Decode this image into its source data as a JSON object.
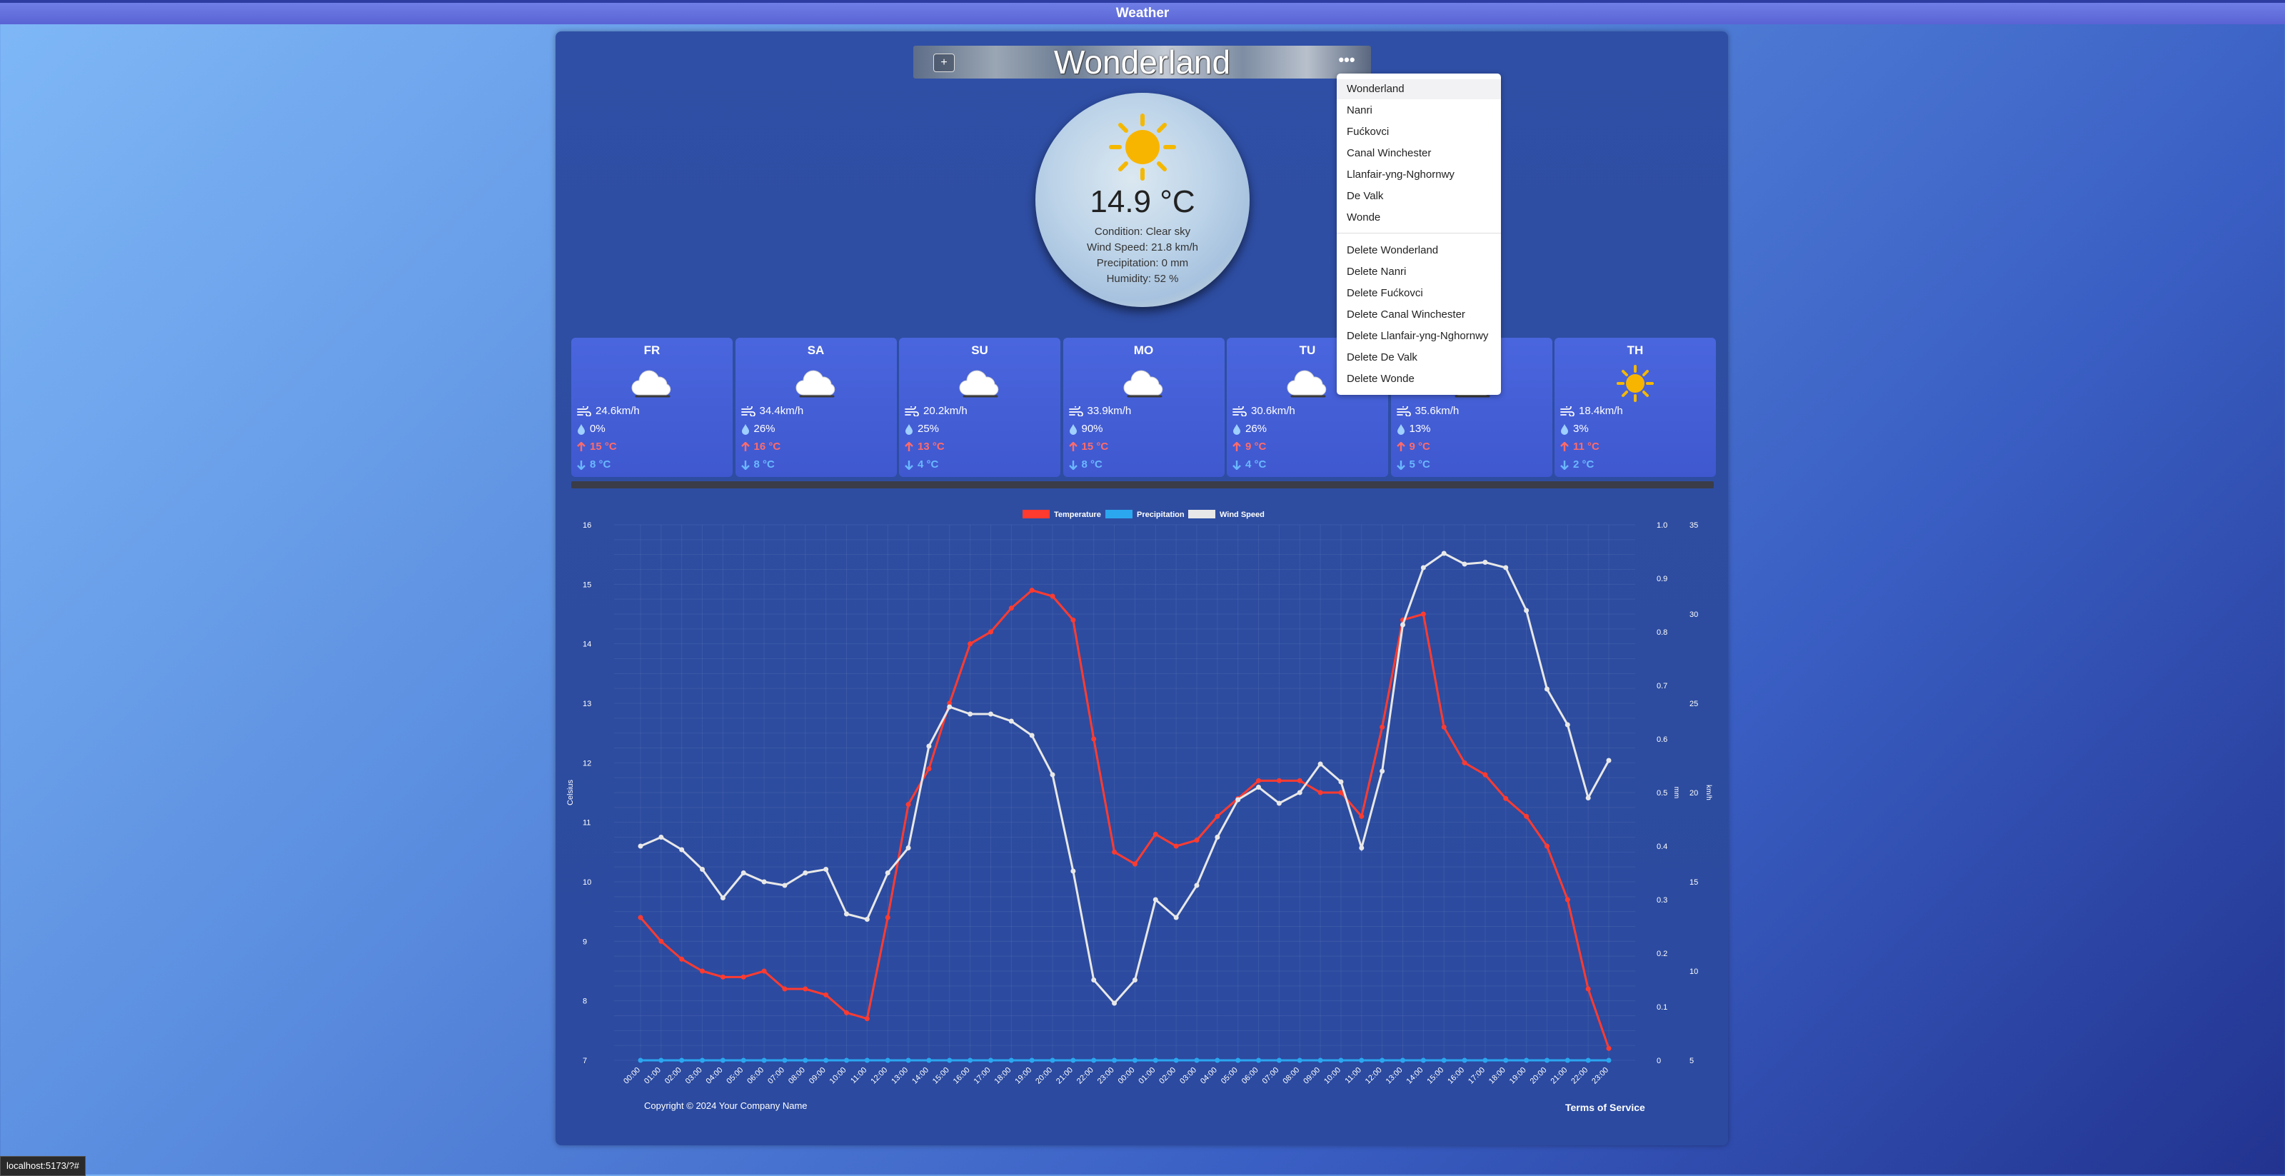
{
  "app": {
    "title": "Weather"
  },
  "location": {
    "name": "Wonderland",
    "add_label": "+",
    "more_label": "•••"
  },
  "menu": {
    "locations": [
      "Wonderland",
      "Nanri",
      "Fućkovci",
      "Canal Winchester",
      "Llanfair-yng-Nghornwy",
      "De Valk",
      "Wonde"
    ],
    "deletes": [
      "Delete Wonderland",
      "Delete Nanri",
      "Delete Fućkovci",
      "Delete Canal Winchester",
      "Delete Llanfair-yng-Nghornwy",
      "Delete De Valk",
      "Delete Wonde"
    ]
  },
  "current": {
    "temperature": "14.9 °C",
    "condition": "Condition: Clear sky",
    "wind": "Wind Speed: 21.8 km/h",
    "precipitation": "Precipitation: 0 mm",
    "humidity": "Humidity: 52 %",
    "icon": "sun-icon"
  },
  "forecast": [
    {
      "day": "FR",
      "icon": "cloud-icon",
      "wind": "24.6km/h",
      "precip": "0%",
      "high": "15 °C",
      "low": "8 °C"
    },
    {
      "day": "SA",
      "icon": "cloud-icon",
      "wind": "34.4km/h",
      "precip": "26%",
      "high": "16 °C",
      "low": "8 °C"
    },
    {
      "day": "SU",
      "icon": "cloud-icon",
      "wind": "20.2km/h",
      "precip": "25%",
      "high": "13 °C",
      "low": "4 °C"
    },
    {
      "day": "MO",
      "icon": "cloud-icon",
      "wind": "33.9km/h",
      "precip": "90%",
      "high": "15 °C",
      "low": "8 °C"
    },
    {
      "day": "TU",
      "icon": "cloud-icon",
      "wind": "30.6km/h",
      "precip": "26%",
      "high": "9 °C",
      "low": "4 °C"
    },
    {
      "day": "",
      "icon": "cloud-icon",
      "wind": "35.6km/h",
      "precip": "13%",
      "high": "9 °C",
      "low": "5 °C"
    },
    {
      "day": "TH",
      "icon": "sun-icon",
      "wind": "18.4km/h",
      "precip": "3%",
      "high": "11 °C",
      "low": "2 °C"
    }
  ],
  "chart_data": {
    "type": "line",
    "legend": [
      "Temperature",
      "Precipitation",
      "Wind Speed"
    ],
    "colors": {
      "temperature": "#ff3b30",
      "precipitation": "#2ba7f0",
      "wind": "#e8e8e8"
    },
    "x": [
      "00:00",
      "01:00",
      "02:00",
      "03:00",
      "04:00",
      "05:00",
      "06:00",
      "07:00",
      "08:00",
      "09:00",
      "10:00",
      "11:00",
      "12:00",
      "13:00",
      "14:00",
      "15:00",
      "16:00",
      "17:00",
      "18:00",
      "19:00",
      "20:00",
      "21:00",
      "22:00",
      "23:00",
      "00:00",
      "01:00",
      "02:00",
      "03:00",
      "04:00",
      "05:00",
      "06:00",
      "07:00",
      "08:00",
      "09:00",
      "10:00",
      "11:00",
      "12:00",
      "13:00",
      "14:00",
      "15:00",
      "16:00",
      "17:00",
      "18:00",
      "19:00",
      "20:00",
      "21:00",
      "22:00",
      "23:00"
    ],
    "series": [
      {
        "name": "Temperature",
        "axis": "Celsius",
        "values": [
          9.4,
          9.0,
          8.7,
          8.5,
          8.4,
          8.4,
          8.5,
          8.2,
          8.2,
          8.1,
          7.8,
          7.7,
          9.4,
          11.3,
          11.9,
          13.0,
          14.0,
          14.2,
          14.6,
          14.9,
          14.8,
          14.4,
          12.4,
          10.5,
          10.3,
          10.8,
          10.6,
          10.7,
          11.1,
          11.4,
          11.7,
          11.7,
          11.7,
          11.5,
          11.5,
          11.1,
          12.6,
          14.4,
          14.5,
          12.6,
          12.0,
          11.8,
          11.4,
          11.1,
          10.6,
          9.7,
          8.2,
          7.2
        ]
      },
      {
        "name": "Precipitation",
        "axis": "mm",
        "values": [
          0,
          0,
          0,
          0,
          0,
          0,
          0,
          0,
          0,
          0,
          0,
          0,
          0,
          0,
          0,
          0,
          0,
          0,
          0,
          0,
          0,
          0,
          0,
          0,
          0,
          0,
          0,
          0,
          0,
          0,
          0,
          0,
          0,
          0,
          0,
          0,
          0,
          0,
          0,
          0,
          0,
          0,
          0,
          0,
          0,
          0,
          0,
          0
        ]
      },
      {
        "name": "Wind Speed",
        "axis": "km/h",
        "values": [
          17.0,
          17.5,
          16.8,
          15.7,
          14.1,
          15.5,
          15.0,
          14.8,
          15.5,
          15.7,
          13.2,
          12.9,
          15.5,
          16.9,
          22.6,
          24.8,
          24.4,
          24.4,
          24.0,
          23.2,
          21.0,
          15.6,
          9.5,
          8.2,
          9.5,
          14.0,
          13.0,
          14.8,
          17.5,
          19.6,
          20.3,
          19.4,
          20.0,
          21.6,
          20.6,
          16.9,
          21.2,
          29.4,
          32.6,
          33.4,
          32.8,
          32.9,
          32.6,
          30.2,
          25.8,
          23.8,
          19.7,
          21.8
        ]
      }
    ],
    "y_left": {
      "label": "Celsius",
      "ticks": [
        7,
        8,
        9,
        10,
        11,
        12,
        13,
        14,
        15,
        16
      ],
      "range": [
        7,
        16
      ]
    },
    "y_right1": {
      "label": "mm",
      "ticks": [
        "0",
        "0.1",
        "0.2",
        "0.3",
        "0.4",
        "0.5",
        "0.6",
        "0.7",
        "0.8",
        "0.9",
        "1.0"
      ],
      "range": [
        0,
        1
      ]
    },
    "y_right2": {
      "label": "km/h",
      "ticks": [
        5,
        10,
        15,
        20,
        25,
        30,
        35
      ],
      "range": [
        5,
        35
      ]
    },
    "grid": true,
    "legend_position": "top-center"
  },
  "footer": {
    "copyright": "Copyright © 2024 Your Company Name",
    "terms": "Terms of Service"
  },
  "status_url": "localhost:5173/?#"
}
